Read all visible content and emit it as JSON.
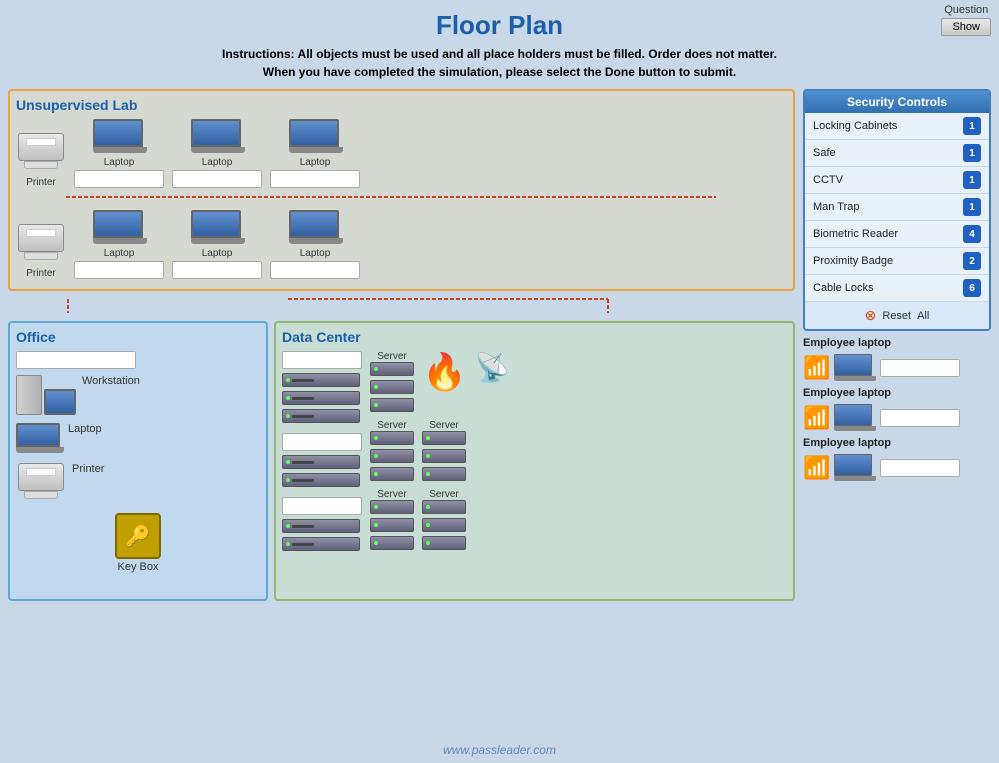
{
  "page": {
    "title": "Floor Plan",
    "instructions_line1": "Instructions: All objects must be used and all place holders must be filled. Order does not matter.",
    "instructions_line2": "When you have completed the simulation, please select the Done button to submit."
  },
  "question_button": {
    "label": "Question",
    "show": "Show"
  },
  "areas": {
    "lab": {
      "label": "Unsupervised Lab",
      "row1": [
        "Printer",
        "Laptop",
        "Laptop",
        "Laptop"
      ],
      "row2": [
        "Printer",
        "Laptop",
        "Laptop",
        "Laptop"
      ]
    },
    "office": {
      "label": "Office",
      "items": [
        "Workstation",
        "Laptop",
        "Printer",
        "Key Box"
      ]
    },
    "datacenter": {
      "label": "Data Center",
      "items": [
        "Server",
        "Server",
        "Server",
        "Server",
        "Server"
      ]
    }
  },
  "security_controls": {
    "header": "Security Controls",
    "items": [
      {
        "label": "Locking Cabinets",
        "count": "1"
      },
      {
        "label": "Safe",
        "count": "1"
      },
      {
        "label": "CCTV",
        "count": "1"
      },
      {
        "label": "Man Trap",
        "count": "1"
      },
      {
        "label": "Biometric Reader",
        "count": "4"
      },
      {
        "label": "Proximity Badge",
        "count": "2"
      },
      {
        "label": "Cable Locks",
        "count": "6"
      }
    ],
    "reset_label": "Reset",
    "all_label": "All"
  },
  "employee_laptops": [
    {
      "label": "Employee laptop"
    },
    {
      "label": "Employee laptop"
    },
    {
      "label": "Employee laptop"
    }
  ],
  "watermark": "www.passleader.com"
}
